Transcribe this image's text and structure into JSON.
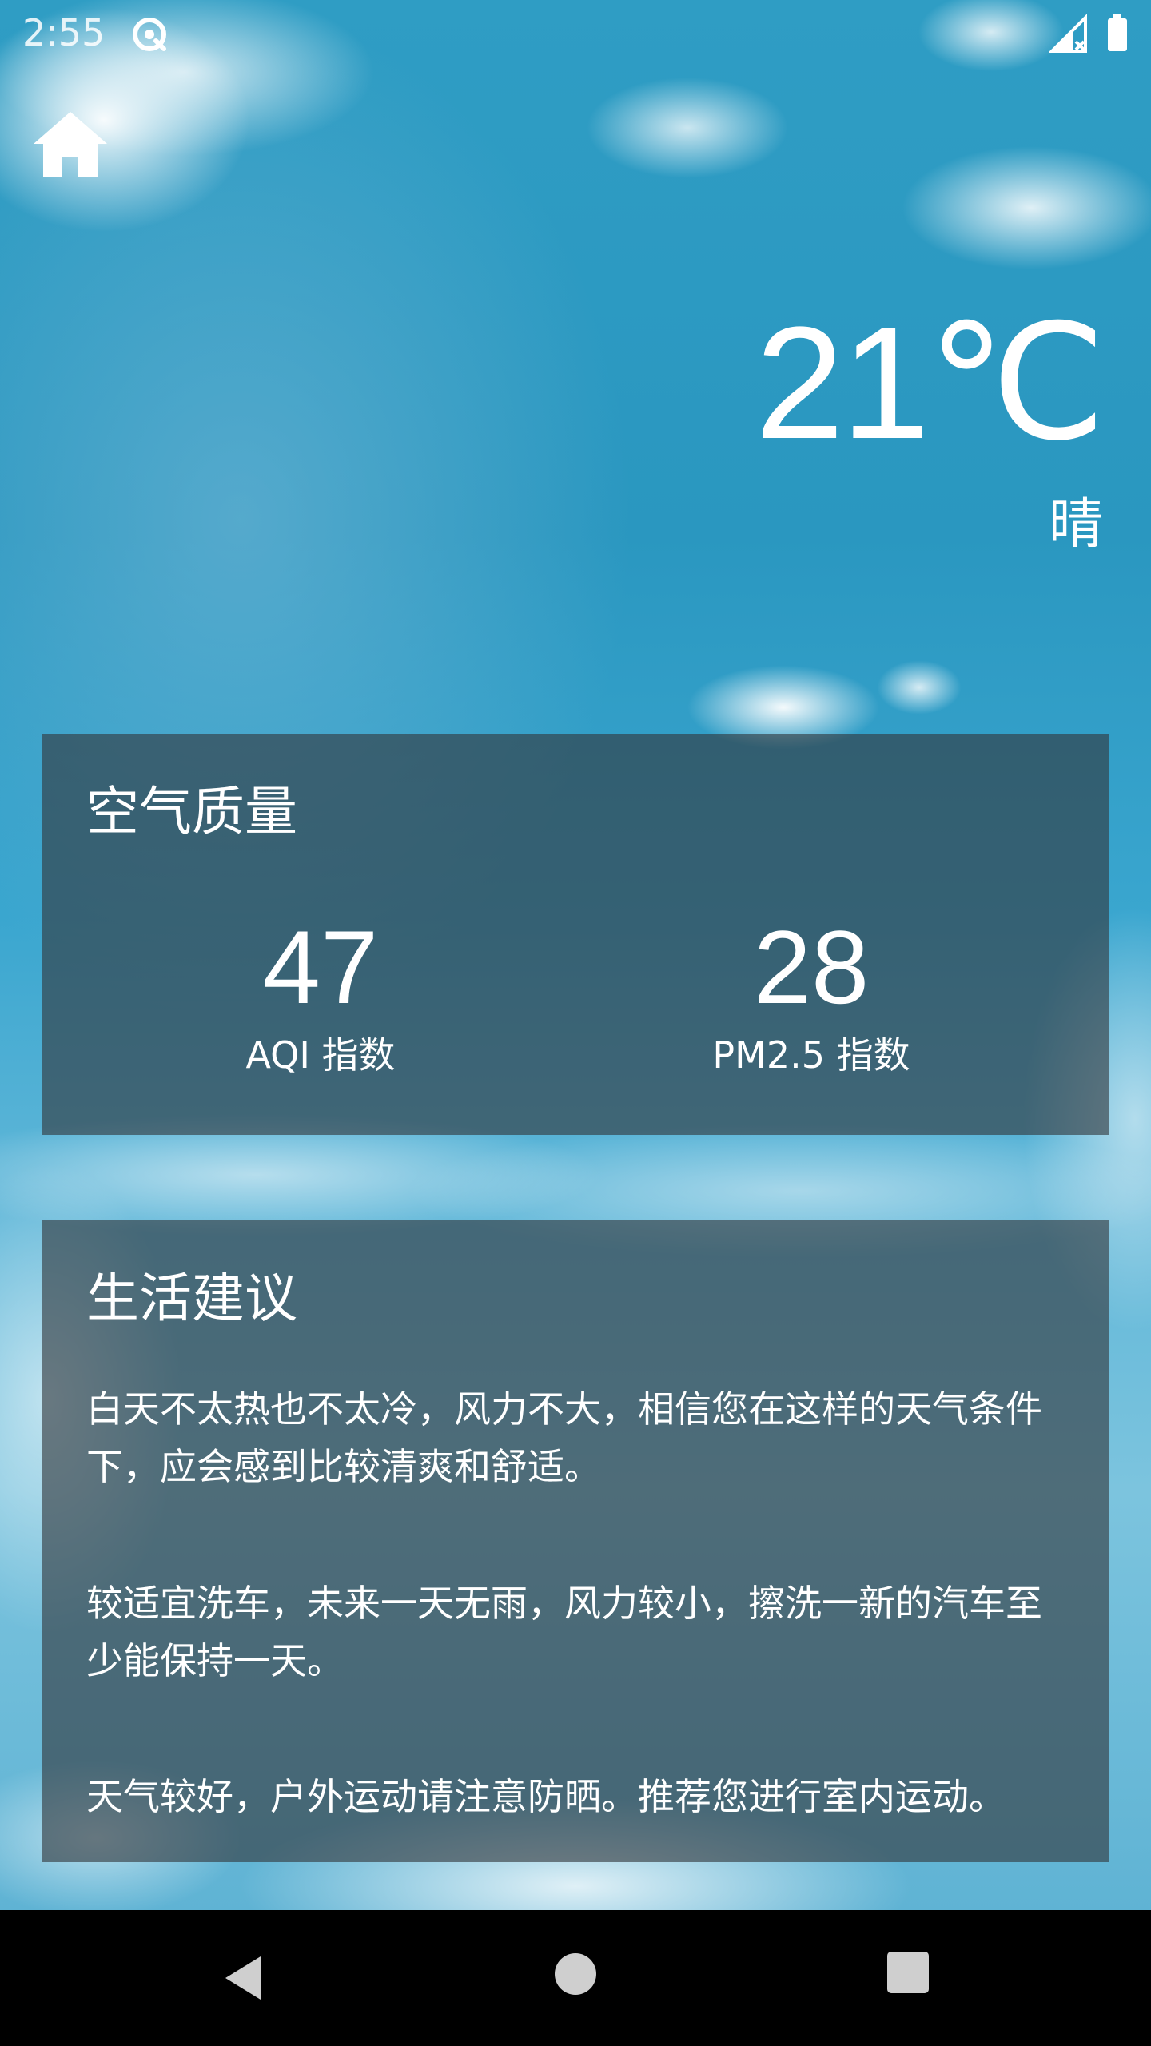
{
  "status_bar": {
    "time": "2:55",
    "sync_icon": "sync-icon",
    "signal_icon": "signal-no-data-icon",
    "battery_icon": "battery-icon"
  },
  "toolbar": {
    "home_icon": "home-icon"
  },
  "weather": {
    "temperature": "21℃",
    "condition": "晴"
  },
  "air_quality": {
    "title": "空气质量",
    "aqi_value": "47",
    "aqi_label": "AQI 指数",
    "pm25_value": "28",
    "pm25_label": "PM2.5 指数"
  },
  "life_suggestion": {
    "title": "生活建议",
    "comfort": "白天不太热也不太冷，风力不大，相信您在这样的天气条件下，应会感到比较清爽和舒适。",
    "car_wash": "较适宜洗车，未来一天无雨，风力较小，擦洗一新的汽车至少能保持一天。",
    "sport": "天气较好，户外运动请注意防晒。推荐您进行室内运动。"
  },
  "navigation": {
    "back_icon": "back-icon",
    "home_icon": "nav-home-icon",
    "recents_icon": "recents-icon"
  },
  "colors": {
    "sky": "#2f9dc4",
    "card_overlay": "#32373c",
    "text": "#ffffff",
    "nav_bar": "#000000"
  }
}
